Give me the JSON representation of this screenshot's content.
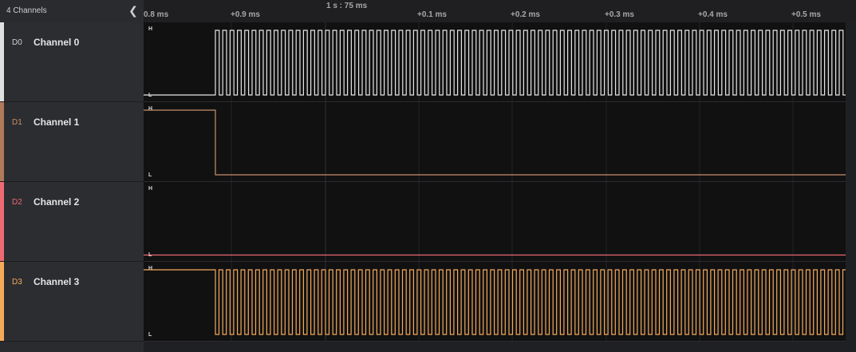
{
  "sidebar": {
    "title": "4 Channels",
    "collapse_icon": "chevron-left-icon",
    "channels": [
      {
        "id": "D0",
        "name": "Channel 0",
        "color": "#e0e0e0"
      },
      {
        "id": "D1",
        "name": "Channel 1",
        "color": "#c8906a"
      },
      {
        "id": "D2",
        "name": "Channel 2",
        "color": "#ee6a72"
      },
      {
        "id": "D3",
        "name": "Channel 3",
        "color": "#f5aa58"
      }
    ]
  },
  "ruler": {
    "center_label": "1 s : 75 ms",
    "ticks": [
      "0.8 ms",
      "+0.9 ms",
      "+0.1 ms",
      "+0.2 ms",
      "+0.3 ms",
      "+0.4 ms",
      "+0.5 ms"
    ]
  },
  "level_labels": {
    "high": "H",
    "low": "L"
  }
}
